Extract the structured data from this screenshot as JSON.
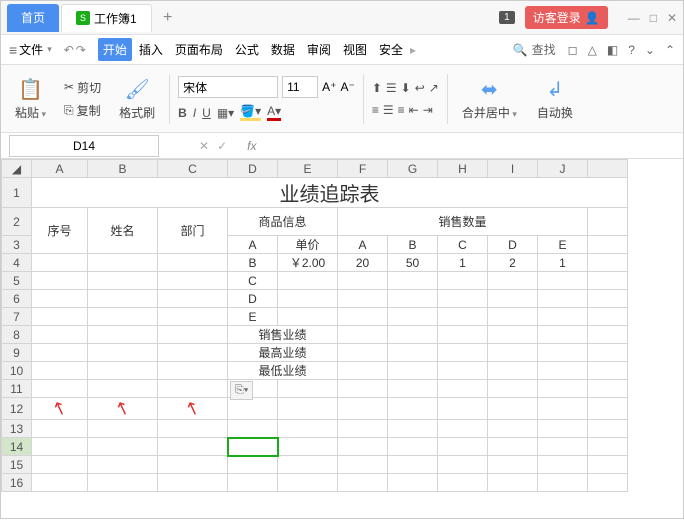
{
  "titlebar": {
    "home": "首页",
    "doc": "工作簿1",
    "badge": "1",
    "guest": "访客登录"
  },
  "menu": {
    "file": "文件",
    "tabs": [
      "开始",
      "插入",
      "页面布局",
      "公式",
      "数据",
      "审阅",
      "视图",
      "安全"
    ],
    "search": "查找"
  },
  "ribbon": {
    "paste": "粘贴",
    "cut": "剪切",
    "copy": "复制",
    "format_painter": "格式刷",
    "font": "宋体",
    "size": "11",
    "merge": "合并居中",
    "autofit": "自动换"
  },
  "namebox": "D14",
  "headers": [
    "A",
    "B",
    "C",
    "D",
    "E",
    "F",
    "G",
    "H",
    "I",
    "J"
  ],
  "rows": [
    "1",
    "2",
    "3",
    "4",
    "5",
    "6",
    "7",
    "8",
    "9",
    "10",
    "11",
    "12",
    "13",
    "14",
    "15",
    "16"
  ],
  "cells": {
    "title": "业绩追踪表",
    "seq": "序号",
    "name": "姓名",
    "dept": "部门",
    "goods": "商品信息",
    "qty": "销售数量",
    "price_lbl": "单价",
    "letters": {
      "a": "A",
      "b": "B",
      "c": "C",
      "d": "D",
      "e": "E"
    },
    "price_val": "￥2.00",
    "q1": "20",
    "q2": "50",
    "q3": "1",
    "q4": "2",
    "q5": "1",
    "sales": "销售业绩",
    "max": "最高业绩",
    "min": "最低业绩"
  }
}
